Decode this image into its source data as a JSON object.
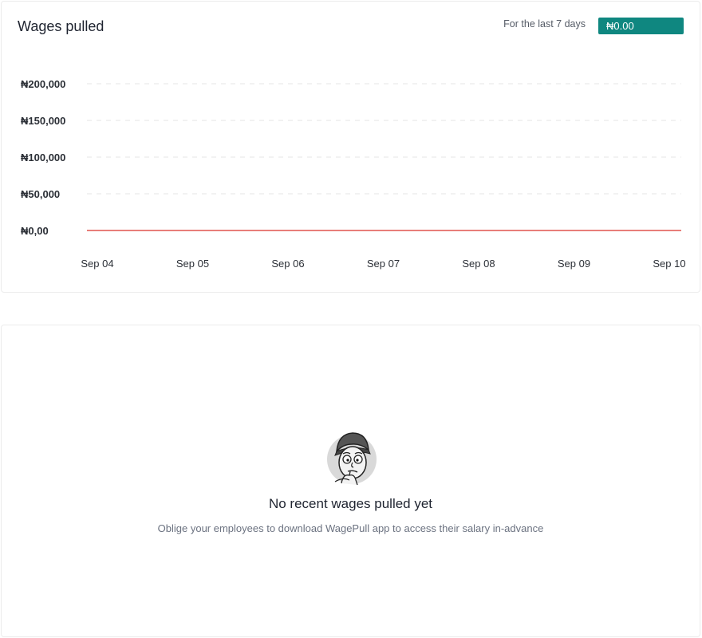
{
  "chart_card": {
    "title": "Wages pulled",
    "period_label": "For the last 7 days",
    "total_value": "₦0.00"
  },
  "chart_data": {
    "type": "line",
    "title": "Wages pulled",
    "xlabel": "",
    "ylabel": "",
    "categories": [
      "Sep 04",
      "Sep 05",
      "Sep 06",
      "Sep 07",
      "Sep 08",
      "Sep 09",
      "Sep 10"
    ],
    "series": [
      {
        "values": [
          0,
          0,
          0,
          0,
          0,
          0,
          0
        ],
        "color": "#e0534f"
      }
    ],
    "ylim": [
      0,
      200000
    ],
    "y_ticks": [
      0,
      50000,
      100000,
      150000,
      200000
    ],
    "y_tick_labels": [
      "₦0,00",
      "₦50,000",
      "₦100,000",
      "₦150,000",
      "₦200,000"
    ],
    "grid": true,
    "grid_style": "dashed"
  },
  "empty_state": {
    "illustration": "confused-face-illustration",
    "title": "No recent wages pulled yet",
    "subtitle": "Oblige your employees to download WagePull app to access their salary in-advance"
  },
  "colors": {
    "accent": "#0f8780",
    "line": "#e0534f",
    "grid": "#e6e6e6"
  }
}
